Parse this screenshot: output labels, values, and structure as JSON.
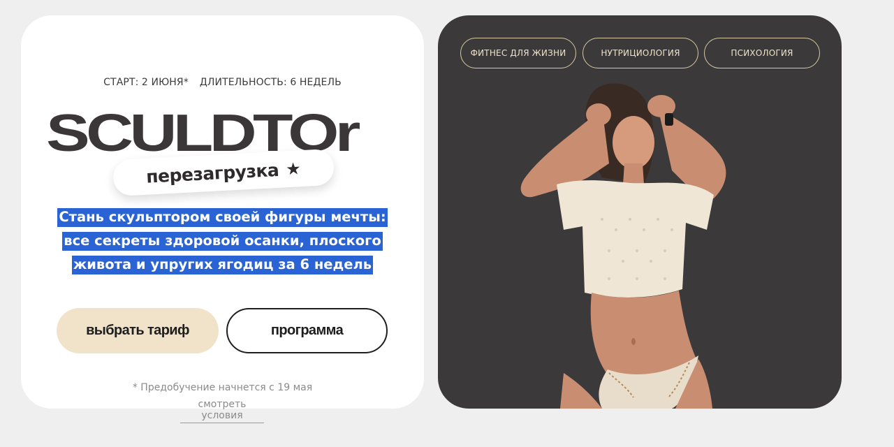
{
  "hero": {
    "start_label": "СТАРТ: 2 ИЮНЯ*",
    "duration_label": "ДЛИТЕЛЬНОСТЬ: 6 НЕДЕЛЬ",
    "logo_text": "SCULDTOr",
    "reload_label": "перезагрузка",
    "reload_icon": "star-icon",
    "headline_bold": "Стань скульптором своей фигуры мечты:",
    "headline_line2": "все секреты здоровой осанки, плоского",
    "headline_line3": "живота и упругих ягодиц за 6 недель",
    "cta_primary": "выбрать тариф",
    "cta_secondary": "программа",
    "note": "* Предобучение начнется с 19 мая",
    "terms_link": "смотреть условия"
  },
  "tags": [
    "ФИТНЕС ДЛЯ ЖИЗНИ",
    "НУТРИЦИОЛОГИЯ",
    "ПСИХОЛОГИЯ"
  ],
  "colors": {
    "page_bg": "#efefef",
    "card_light": "#ffffff",
    "card_dark": "#3b3939",
    "accent_beige": "#f1e3c9",
    "highlight_blue": "#2a63d4",
    "tag_border": "#d9c9a5"
  }
}
